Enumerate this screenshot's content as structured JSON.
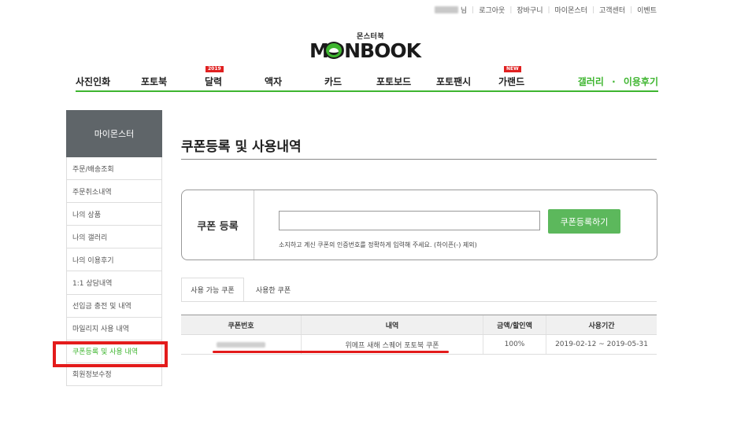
{
  "util_bar": {
    "user_suffix": "님",
    "links": [
      "로그아웃",
      "장바구니",
      "마이몬스터",
      "고객센터",
      "이벤트"
    ]
  },
  "logo": {
    "small_text": "몬스터북",
    "big_text": "MONBOOK"
  },
  "nav": {
    "items": [
      {
        "label": "사진인화",
        "badge": ""
      },
      {
        "label": "포토북",
        "badge": ""
      },
      {
        "label": "달력",
        "badge": "2019"
      },
      {
        "label": "액자",
        "badge": ""
      },
      {
        "label": "카드",
        "badge": ""
      },
      {
        "label": "포토보드",
        "badge": ""
      },
      {
        "label": "포토팬시",
        "badge": ""
      },
      {
        "label": "가랜드",
        "badge": "NEW"
      }
    ],
    "gallery_label": "갤러리",
    "dot": "·",
    "reviews_label": "이용후기",
    "accent_color": "#3eb52f"
  },
  "sidebar": {
    "header": "마이몬스터",
    "items": [
      {
        "label": "주문/배송조회"
      },
      {
        "label": "주문취소내역"
      },
      {
        "label": "나의 상품"
      },
      {
        "label": "나의 갤러리"
      },
      {
        "label": "나의 이용후기"
      },
      {
        "label": "1:1 상담내역"
      },
      {
        "label": "선입금 충전 및 내역"
      },
      {
        "label": "마일리지 사용 내역"
      },
      {
        "label": "쿠폰등록 및 사용 내역"
      },
      {
        "label": "회원정보수정"
      }
    ],
    "active_index": 8
  },
  "main": {
    "title": "쿠폰등록 및 사용내역",
    "register": {
      "label": "쿠폰 등록",
      "input_value": "",
      "button_label": "쿠폰등록하기",
      "hint": "소지하고 계신 쿠폰의 인증번호를 정확하게 입력해 주세요. (하이픈(-) 제외)"
    },
    "tabs": [
      {
        "label": "사용 가능 쿠폰",
        "active": true
      },
      {
        "label": "사용한 쿠폰",
        "active": false
      }
    ],
    "table": {
      "headers": [
        "쿠폰번호",
        "내역",
        "금액/할인액",
        "사용기간"
      ],
      "rows": [
        {
          "description": "위메프 새해 스퀘어 포토북 쿠폰",
          "amount": "100%",
          "period": "2019-02-12 ~ 2019-05-31"
        }
      ]
    }
  },
  "colors": {
    "highlight_red": "#e31b1b",
    "button_green": "#5cb85c",
    "sidebar_header": "#5f6569"
  }
}
